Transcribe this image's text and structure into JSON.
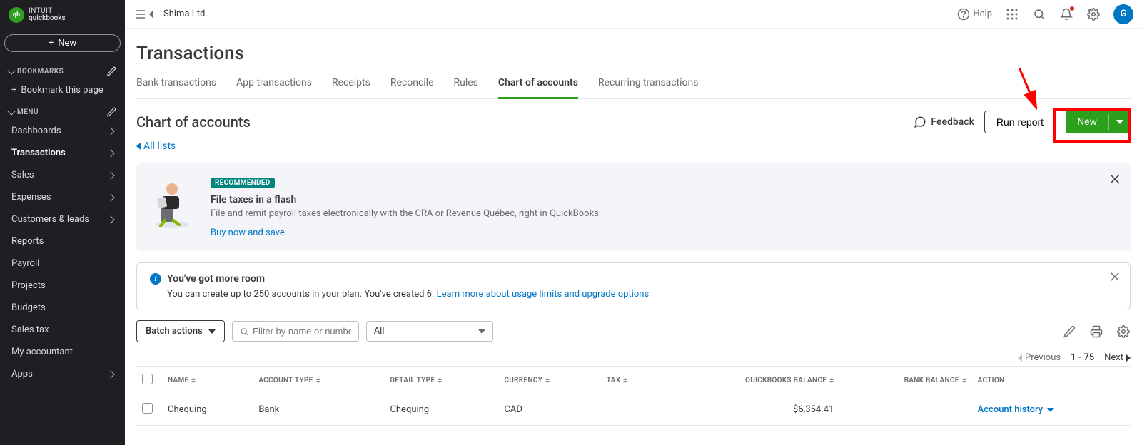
{
  "brand": {
    "intuit": "INTUIT",
    "product": "quickbooks",
    "logo_initials": "qb"
  },
  "sidebar": {
    "new_label": "New",
    "bookmarks_label": "BOOKMARKS",
    "bookmark_page": "Bookmark this page",
    "menu_label": "MENU",
    "items": [
      {
        "label": "Dashboards",
        "chevron": true
      },
      {
        "label": "Transactions",
        "chevron": true,
        "active": true
      },
      {
        "label": "Sales",
        "chevron": true
      },
      {
        "label": "Expenses",
        "chevron": true
      },
      {
        "label": "Customers & leads",
        "chevron": true
      },
      {
        "label": "Reports",
        "chevron": false
      },
      {
        "label": "Payroll",
        "chevron": false
      },
      {
        "label": "Projects",
        "chevron": false
      },
      {
        "label": "Budgets",
        "chevron": false
      },
      {
        "label": "Sales tax",
        "chevron": false
      },
      {
        "label": "My accountant",
        "chevron": false
      },
      {
        "label": "Apps",
        "chevron": true
      }
    ]
  },
  "topbar": {
    "company": "Shima Ltd.",
    "help": "Help",
    "avatar_initial": "G"
  },
  "page": {
    "title": "Transactions",
    "tabs": [
      "Bank transactions",
      "App transactions",
      "Receipts",
      "Reconcile",
      "Rules",
      "Chart of accounts",
      "Recurring transactions"
    ],
    "active_tab": 5,
    "section_title": "Chart of accounts",
    "feedback": "Feedback",
    "run_report": "Run report",
    "new_btn": "New",
    "all_lists": "All lists"
  },
  "reco": {
    "badge": "RECOMMENDED",
    "title": "File taxes in a flash",
    "sub": "File and remit payroll taxes electronically with the CRA or Revenue Québec, right in QuickBooks.",
    "link": "Buy now and save"
  },
  "info": {
    "title": "You've got more room",
    "sub_text": "You can create up to 250 accounts in your plan. You've created 6. ",
    "link": "Learn more about usage limits and upgrade options"
  },
  "toolbar": {
    "batch": "Batch actions",
    "filter_placeholder": "Filter by name or number",
    "select_value": "All"
  },
  "pagination": {
    "prev": "Previous",
    "range": "1 - 75",
    "next": "Next"
  },
  "table": {
    "headers": [
      "NAME",
      "ACCOUNT TYPE",
      "DETAIL TYPE",
      "CURRENCY",
      "TAX",
      "QUICKBOOKS BALANCE",
      "BANK BALANCE",
      "ACTION"
    ],
    "row": {
      "name": "Chequing",
      "account_type": "Bank",
      "detail_type": "Chequing",
      "currency": "CAD",
      "tax": "",
      "qb_balance": "$6,354.41",
      "bank_balance": "",
      "action": "Account history"
    }
  }
}
